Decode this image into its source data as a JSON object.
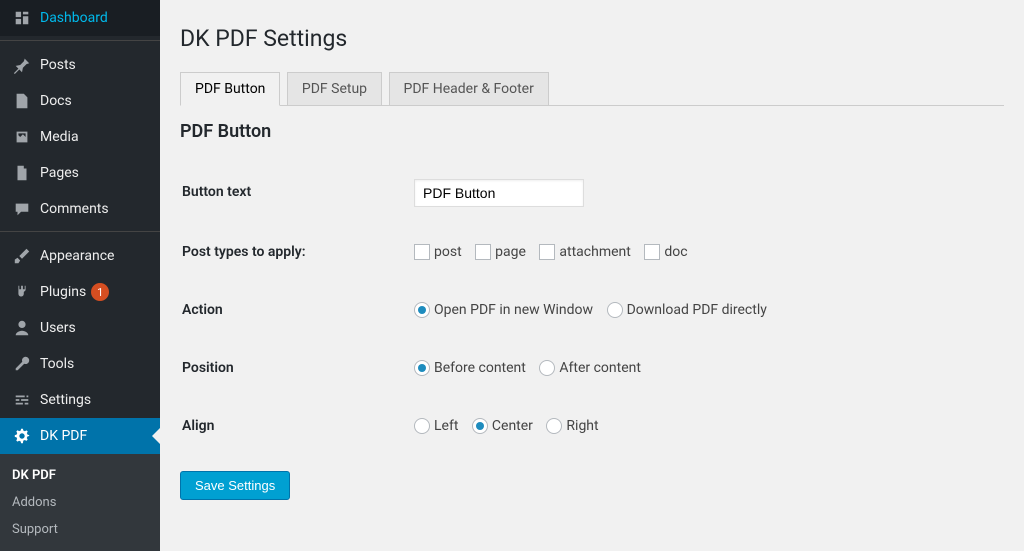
{
  "sidebar": {
    "items": [
      {
        "label": "Dashboard",
        "icon": "dashboard"
      },
      {
        "label": "Posts",
        "icon": "pin"
      },
      {
        "label": "Docs",
        "icon": "doc"
      },
      {
        "label": "Media",
        "icon": "media"
      },
      {
        "label": "Pages",
        "icon": "page"
      },
      {
        "label": "Comments",
        "icon": "comment"
      },
      {
        "label": "Appearance",
        "icon": "brush"
      },
      {
        "label": "Plugins",
        "icon": "plug",
        "badge": "1"
      },
      {
        "label": "Users",
        "icon": "user"
      },
      {
        "label": "Tools",
        "icon": "wrench"
      },
      {
        "label": "Settings",
        "icon": "sliders"
      },
      {
        "label": "DK PDF",
        "icon": "gear",
        "current": true
      }
    ],
    "submenu": [
      {
        "label": "DK PDF",
        "current": true
      },
      {
        "label": "Addons"
      },
      {
        "label": "Support"
      }
    ]
  },
  "page": {
    "title": "DK PDF Settings",
    "section_title": "PDF Button",
    "tabs": [
      {
        "label": "PDF Button",
        "active": true
      },
      {
        "label": "PDF Setup"
      },
      {
        "label": "PDF Header & Footer"
      }
    ]
  },
  "form": {
    "button_text_label": "Button text",
    "button_text_value": "PDF Button",
    "post_types_label": "Post types to apply:",
    "post_types": [
      {
        "label": "post"
      },
      {
        "label": "page"
      },
      {
        "label": "attachment"
      },
      {
        "label": "doc"
      }
    ],
    "action_label": "Action",
    "action_options": [
      {
        "label": "Open PDF in new Window",
        "checked": true
      },
      {
        "label": "Download PDF directly"
      }
    ],
    "position_label": "Position",
    "position_options": [
      {
        "label": "Before content",
        "checked": true
      },
      {
        "label": "After content"
      }
    ],
    "align_label": "Align",
    "align_options": [
      {
        "label": "Left"
      },
      {
        "label": "Center",
        "checked": true
      },
      {
        "label": "Right"
      }
    ],
    "save_label": "Save Settings"
  }
}
